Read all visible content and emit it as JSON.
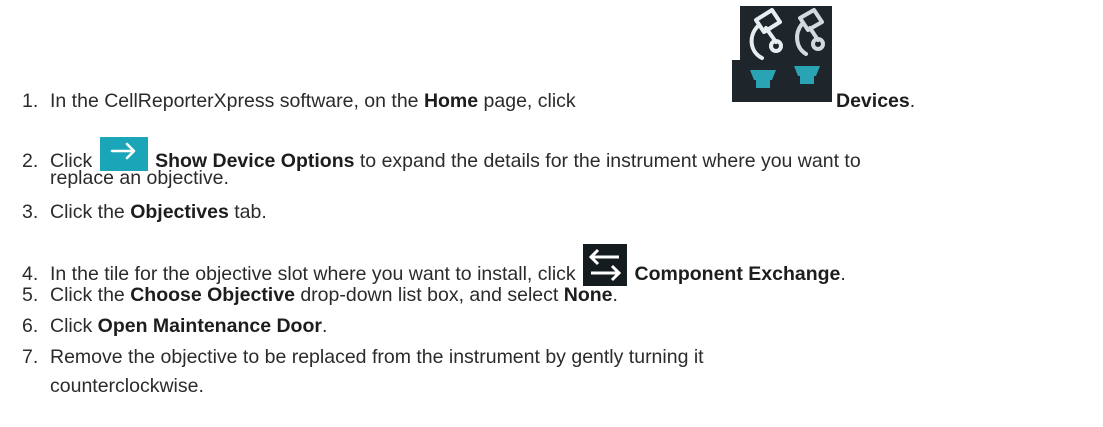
{
  "icons": {
    "devices": {
      "name": "microscope-devices-icon",
      "bg": "#1f262b",
      "accent": "#2aa3b5"
    },
    "show_options": {
      "name": "arrow-right-icon",
      "bg": "#1aa6b8"
    },
    "component_exchange": {
      "name": "exchange-arrows-icon",
      "bg": "#151c1f"
    }
  },
  "steps": [
    {
      "n": "1.",
      "a": "In the CellReporterXpress software, on the ",
      "b1": "Home",
      "c": " page, click ",
      "b2": "Devices",
      "d": "."
    },
    {
      "n": "2.",
      "a": "Click ",
      "b1": "Show Device Options",
      "c": " to expand the details for the instrument where you want to",
      "line2": "replace an objective."
    },
    {
      "n": "3.",
      "a": "Click the ",
      "b1": "Objectives",
      "c": " tab."
    },
    {
      "n": "4.",
      "a": "In the tile for the objective slot where you want to install, click ",
      "b1": "Component Exchange",
      "c": "."
    },
    {
      "n": "5.",
      "a": "Click the ",
      "b1": "Choose Objective",
      "c": " drop-down list box, and select ",
      "b2": "None",
      "d": "."
    },
    {
      "n": "6.",
      "a": "Click ",
      "b1": "Open Maintenance Door",
      "c": "."
    },
    {
      "n": "7.",
      "a": "Remove the objective to be replaced from the instrument by gently turning it",
      "line2": "counterclockwise."
    }
  ]
}
